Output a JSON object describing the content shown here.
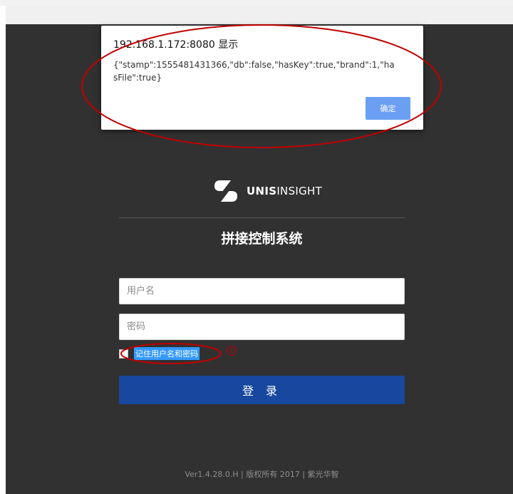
{
  "dialog": {
    "title": "192.168.1.172:8080 显示",
    "message": "{\"stamp\":1555481431366,\"db\":false,\"hasKey\":true,\"brand\":1,\"hasFile\":true}",
    "ok_label": "确定"
  },
  "logo": {
    "bold": "UNIS",
    "rest": "INSIGHT",
    "icon": "unis-logo-icon"
  },
  "login": {
    "title": "拼接控制系统",
    "username_placeholder": "用户名",
    "password_placeholder": "密码",
    "remember_label": "记住用户名和密码",
    "submit_label": "登 录"
  },
  "annotation": {
    "marker": "①"
  },
  "footer": {
    "text": "Ver1.4.28.0.H | 版权所有 2017 | 紫光华智"
  },
  "colors": {
    "background": "#313131",
    "button": "#17479e",
    "dialog_button": "#6b9ff2",
    "annotation": "#c00000"
  }
}
